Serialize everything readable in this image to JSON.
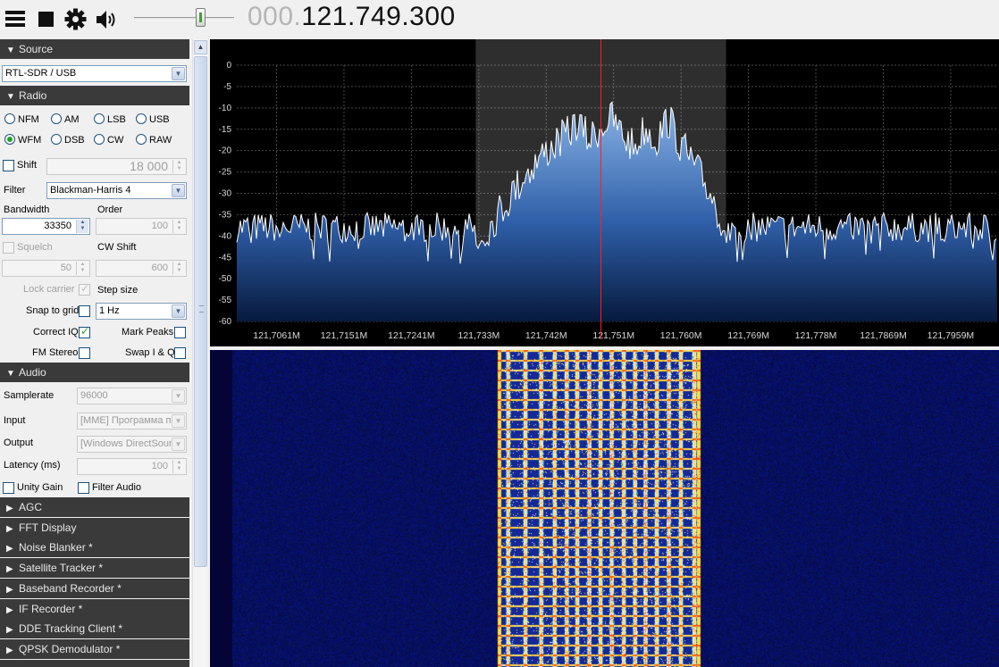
{
  "toolbar": {
    "menu_icon": "hamburger-menu-icon",
    "stop_icon": "stop-icon",
    "settings_icon": "gear-icon",
    "volume_icon": "speaker-icon",
    "volume_level": 0.72,
    "frequency_dim": "000.",
    "frequency_main": "121.749.300"
  },
  "source": {
    "header": "Source",
    "device": "RTL-SDR / USB"
  },
  "radio": {
    "header": "Radio",
    "modes": [
      "NFM",
      "AM",
      "LSB",
      "USB",
      "WFM",
      "DSB",
      "CW",
      "RAW"
    ],
    "selected_mode": "WFM",
    "shift_label": "Shift",
    "shift_value": "18 000",
    "filter_label": "Filter",
    "filter_value": "Blackman-Harris 4",
    "bandwidth_label": "Bandwidth",
    "bandwidth_value": "33350",
    "order_label": "Order",
    "order_value": "100",
    "squelch_label": "Squelch",
    "squelch_value": "50",
    "cw_shift_label": "CW Shift",
    "cw_shift_value": "600",
    "lock_carrier_label": "Lock carrier",
    "step_size_label": "Step size",
    "snap_label": "Snap to grid",
    "step_value": "1 Hz",
    "correct_iq_label": "Correct IQ",
    "mark_peaks_label": "Mark Peaks",
    "fm_stereo_label": "FM Stereo",
    "swap_iq_label": "Swap I & Q"
  },
  "audio": {
    "header": "Audio",
    "samplerate_label": "Samplerate",
    "samplerate_value": "96000",
    "input_label": "Input",
    "input_value": "[MME] Программа пе",
    "output_label": "Output",
    "output_value": "[Windows DirectSoun",
    "latency_label": "Latency (ms)",
    "latency_value": "100",
    "unity_gain_label": "Unity Gain",
    "filter_audio_label": "Filter Audio"
  },
  "collapsed_sections": [
    "AGC",
    "FFT Display",
    "Noise Blanker *",
    "Satellite Tracker *",
    "Baseband Recorder *",
    "IF Recorder *",
    "DDE Tracking Client *",
    "QPSK Demodulator *"
  ],
  "chart_data": {
    "type": "line",
    "title": "",
    "y_ticks": [
      "0",
      "-5",
      "-10",
      "-15",
      "-20",
      "-25",
      "-30",
      "-35",
      "-40",
      "-45",
      "-50",
      "-55",
      "-60"
    ],
    "ylim": [
      -60,
      0
    ],
    "x_ticks": [
      "121,7061M",
      "121,7151M",
      "121,7241M",
      "121,733M",
      "121,742M",
      "121,751M",
      "121,760M",
      "121,769M",
      "121,778M",
      "121,7869M",
      "121,7959M"
    ],
    "xlim_mhz": [
      121.7008,
      121.8021
    ],
    "center_mhz": 121.7493,
    "bandwidth_hz": 33350,
    "series": [
      {
        "x_mhz": [
          121.7322,
          121.7345,
          121.7369,
          121.7392,
          121.7413,
          121.7431,
          121.7447,
          121.7461,
          121.7477,
          121.7492,
          121.7507,
          121.7523,
          121.7538,
          121.7552,
          121.7567,
          121.7583,
          121.7599,
          121.7617,
          121.7641,
          121.7664
        ],
        "y_db": [
          -38,
          -33,
          -27,
          -21,
          -17,
          -14,
          -12,
          -9,
          -13,
          -10,
          -8,
          -12,
          -15,
          -10,
          -13,
          -8,
          -14,
          -19,
          -26,
          -36
        ]
      }
    ],
    "noise_floor_db": -38,
    "grid": true
  }
}
